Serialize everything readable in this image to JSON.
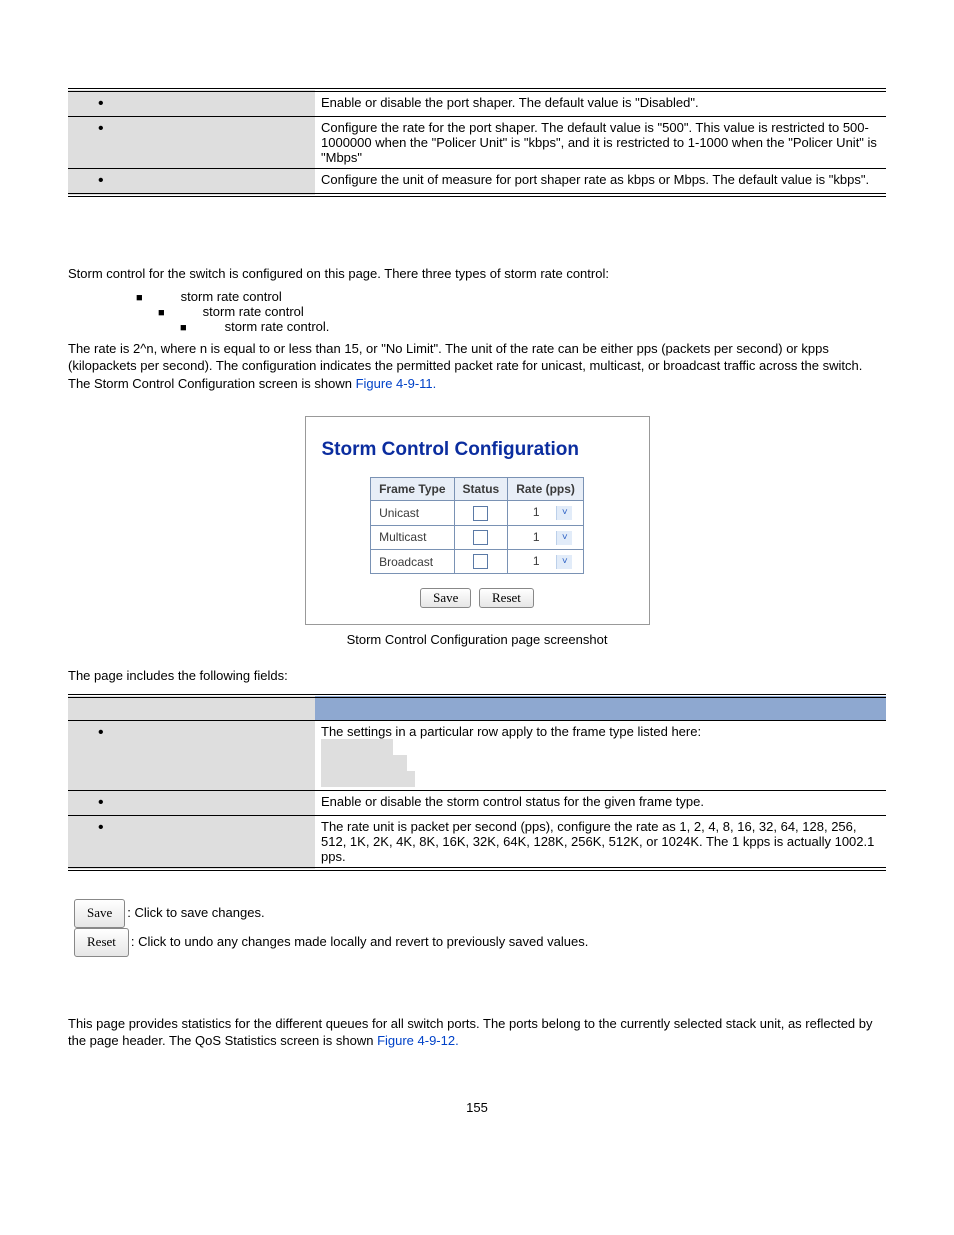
{
  "shaper_rows": [
    "Enable or disable the port shaper. The default value is \"Disabled\".",
    "Configure the rate for the port shaper. The default value is \"500\". This value is restricted to 500-1000000 when the \"Policer Unit\" is \"kbps\", and it is restricted to 1-1000 when the \"Policer Unit\" is \"Mbps\"",
    "Configure the unit of measure for port shaper rate as kbps or Mbps. The default value is \"kbps\"."
  ],
  "storm": {
    "intro": "Storm control for the switch is configured on this page. There three types of storm rate control:",
    "types": [
      "storm rate control",
      "storm rate control",
      "storm rate control."
    ],
    "rate_para_a": "The rate is 2^n, where n is equal to or less than 15, or \"No Limit\". The unit of the rate can be either pps (packets per second) or kpps (kilopackets per second). The configuration indicates the permitted packet rate for unicast, multicast, or broadcast traffic across the switch. The Storm Control Configuration screen is shown ",
    "fig_link": "Figure 4-9-11."
  },
  "figure": {
    "title": "Storm Control Configuration",
    "headers": {
      "ft": "Frame Type",
      "st": "Status",
      "rt": "Rate (pps)"
    },
    "rows": [
      {
        "ft": "Unicast",
        "rate": "1"
      },
      {
        "ft": "Multicast",
        "rate": "1"
      },
      {
        "ft": "Broadcast",
        "rate": "1"
      }
    ],
    "save": "Save",
    "reset": "Reset",
    "caption": "Storm Control Configuration page screenshot"
  },
  "fields_intro": "The page includes the following fields:",
  "param_rows": [
    {
      "desc": "The settings in a particular row apply to the frame type listed here:",
      "subs": []
    },
    {
      "desc": "Enable or disable the storm control status for the given frame type."
    },
    {
      "desc": "The rate unit is packet per second (pps), configure the rate as 1, 2, 4, 8, 16, 32, 64, 128, 256, 512, 1K, 2K, 4K, 8K, 16K, 32K, 64K, 128K, 256K, 512K, or 1024K. The 1 kpps is actually 1002.1 pps."
    }
  ],
  "buttons_explain": {
    "save_btn": "Save",
    "save_txt": ": Click to save changes.",
    "reset_btn": "Reset",
    "reset_txt": ": Click to undo any changes made locally and revert to previously saved values."
  },
  "qos": {
    "para_a": "This page provides statistics for the different queues for all switch ports. The ports belong to the currently selected stack unit, as reflected by the page header. The QoS Statistics screen is shown ",
    "fig_link": "Figure 4-9-12."
  },
  "page_num": "155"
}
